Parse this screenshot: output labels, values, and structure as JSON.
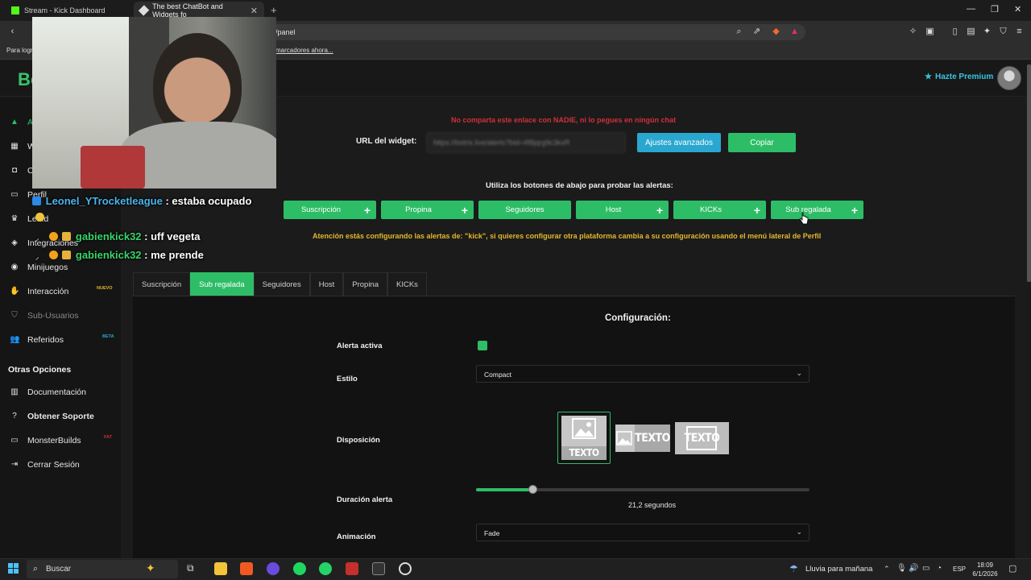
{
  "browser": {
    "tabs": [
      {
        "title": "Stream - Kick Dashboard"
      },
      {
        "title": "The best ChatBot and Widgets fo"
      }
    ],
    "url": "/panel",
    "bookmarks_bar_left": "Para logr",
    "bookmarks_bar_link": "marcadores ahora..."
  },
  "header": {
    "logo_text": "Bo",
    "premium_label": "Hazte Premium"
  },
  "sidebar": {
    "items": [
      {
        "label": "A",
        "icon": "warning-icon"
      },
      {
        "label": "W",
        "icon": "grid-icon"
      },
      {
        "label": "C",
        "icon": "robot-icon"
      },
      {
        "label": "Perfil",
        "icon": "id-card-icon"
      },
      {
        "label": "Le...d",
        "icon": "trophy-icon"
      },
      {
        "label": "Integraciones",
        "icon": "cube-icon"
      },
      {
        "label": "Minijuegos",
        "icon": "gamepad-icon"
      },
      {
        "label": "Interacción",
        "icon": "hand-icon",
        "badge": "NUEVO"
      },
      {
        "label": "Sub-Usuarios",
        "icon": "user-shield-icon"
      },
      {
        "label": "Referidos",
        "icon": "users-icon",
        "badge": "BETA"
      }
    ],
    "section_title": "Otras Opciones",
    "other_items": [
      {
        "label": "Documentación",
        "icon": "book-icon"
      },
      {
        "label": "Obtener Soporte",
        "icon": "question-icon"
      },
      {
        "label": "MonsterBuilds",
        "icon": "monitor-icon",
        "badge": "FAT"
      },
      {
        "label": "Cerrar Sesión",
        "icon": "logout-icon"
      }
    ]
  },
  "widget": {
    "warning": "No comparta este enlace con NADIE, ni lo pegues en ningún chat",
    "url_label": "URL del widget:",
    "url_value": "https://botrix.live/alerts?bid=4f8jqrg9c3kxR",
    "advanced_button": "Ajustes avanzados",
    "copy_button": "Copiar",
    "test_label": "Utiliza los botones de abajo para probar las alertas:",
    "test_buttons": [
      {
        "label": "Suscripción",
        "has_plus": true
      },
      {
        "label": "Propina",
        "has_plus": true
      },
      {
        "label": "Seguidores",
        "has_plus": false
      },
      {
        "label": "Host",
        "has_plus": true
      },
      {
        "label": "KICKs",
        "has_plus": true
      },
      {
        "label": "Sub regalada",
        "has_plus": true
      }
    ],
    "attention": "Atención estás configurando las alertas de: \"kick\", si quieres configurar otra plataforma cambia a su configuración usando el menú lateral de Perfil"
  },
  "config_tabs": [
    "Suscripción",
    "Sub regalada",
    "Seguidores",
    "Host",
    "Propina",
    "KICKs"
  ],
  "active_tab": "Sub regalada",
  "config": {
    "title": "Configuración:",
    "active_label": "Alerta activa",
    "active_checked": true,
    "style_label": "Estilo",
    "style_value": "Compact",
    "layout_label": "Disposición",
    "layout_option_text": "TEXTO",
    "selected_layout_index": 0,
    "duration_label": "Duración alerta",
    "duration_value": "21,2",
    "duration_unit": "segundos",
    "duration_fraction": 0.17,
    "animation_label": "Animación",
    "animation_value": "Fade"
  },
  "chat": [
    {
      "user": "Leonel_YTrocketleague",
      "message": ": estaba ocupado",
      "color": "#4ab4ec"
    },
    {
      "user": "gabienkick32",
      "message": ": uff vegeta",
      "color": "#38d46a"
    },
    {
      "user": "gabienkick32",
      "message": ": me prende",
      "color": "#38d46a"
    }
  ],
  "taskbar": {
    "search_placeholder": "Buscar",
    "weather": "Lluvia para mañana",
    "language": "ESP",
    "time": "18:09",
    "date": "6/1/2026"
  },
  "colors": {
    "accent_green": "#2ebd67",
    "accent_blue": "#29a7cf",
    "warning_red": "#d0303a",
    "attention_yellow": "#e3b72c"
  }
}
